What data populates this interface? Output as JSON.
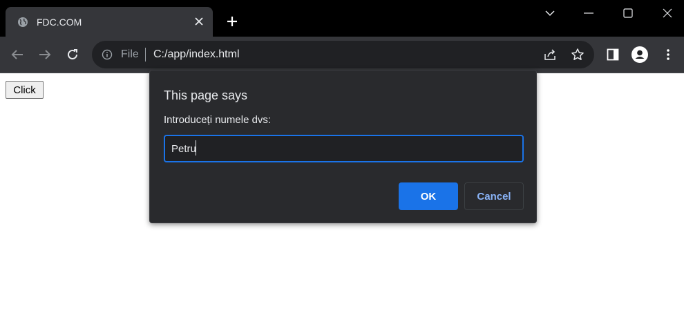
{
  "browser": {
    "tab": {
      "title": "FDC.COM",
      "favicon": "globe-icon",
      "close_icon": "close-icon"
    },
    "new_tab_icon": "plus-icon",
    "window_controls": [
      "chevron-down-icon",
      "minimize-icon",
      "maximize-icon",
      "close-icon"
    ],
    "toolbar": {
      "back_icon": "arrow-left-icon",
      "forward_icon": "arrow-right-icon",
      "reload_icon": "reload-icon",
      "omnibox": {
        "info_icon": "info-icon",
        "scheme": "File",
        "url": "C:/app/index.html",
        "share_icon": "share-icon",
        "star_icon": "star-icon"
      },
      "sidepanel_icon": "side-panel-icon",
      "profile_icon": "avatar-icon",
      "menu_icon": "kebab-menu-icon"
    }
  },
  "page": {
    "button_label": "Click"
  },
  "dialog": {
    "title": "This page says",
    "message": "Introduceți numele dvs:",
    "input_value": "Petru",
    "ok_label": "OK",
    "cancel_label": "Cancel"
  },
  "colors": {
    "titlebar_bg": "#000000",
    "tab_bg": "#35363a",
    "toolbar_bg": "#35363a",
    "omnibox_bg": "#202124",
    "dialog_bg": "#292a2d",
    "accent": "#1a73e8",
    "link_blue": "#8ab4f8"
  }
}
